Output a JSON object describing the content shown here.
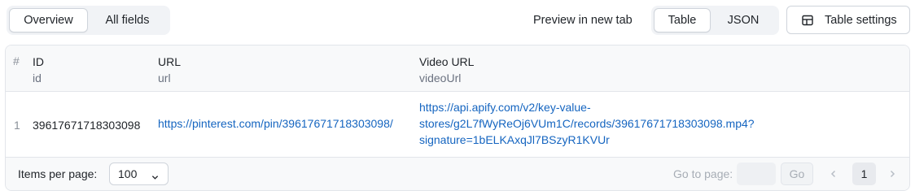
{
  "view_tabs": [
    "Overview",
    "All fields"
  ],
  "preview_label": "Preview in new tab",
  "format_tabs": [
    "Table",
    "JSON"
  ],
  "settings_label": "Table settings",
  "table": {
    "hash": "#",
    "columns": [
      {
        "name": "ID",
        "key": "id"
      },
      {
        "name": "URL",
        "key": "url"
      },
      {
        "name": "Video URL",
        "key": "videoUrl"
      }
    ],
    "rows": [
      {
        "num": "1",
        "id": "39617671718303098",
        "url": "https://pinterest.com/pin/39617671718303098/",
        "video_url_lines": [
          "https://api.apify.com/v2/key-value-",
          "stores/g2L7fWyReOj6VUm1C/records/39617671718303098.mp4?",
          "signature=1bELKAxqJl7BSzyR1KVUr"
        ]
      }
    ]
  },
  "footer": {
    "items_per_page_label": "Items per page:",
    "items_per_page_value": "100",
    "go_to_page_label": "Go to page:",
    "go_label": "Go",
    "current_page": "1"
  },
  "colors": {
    "link": "#1565c0",
    "border": "#e2e5ea",
    "segment_bg": "#f1f3f6"
  }
}
